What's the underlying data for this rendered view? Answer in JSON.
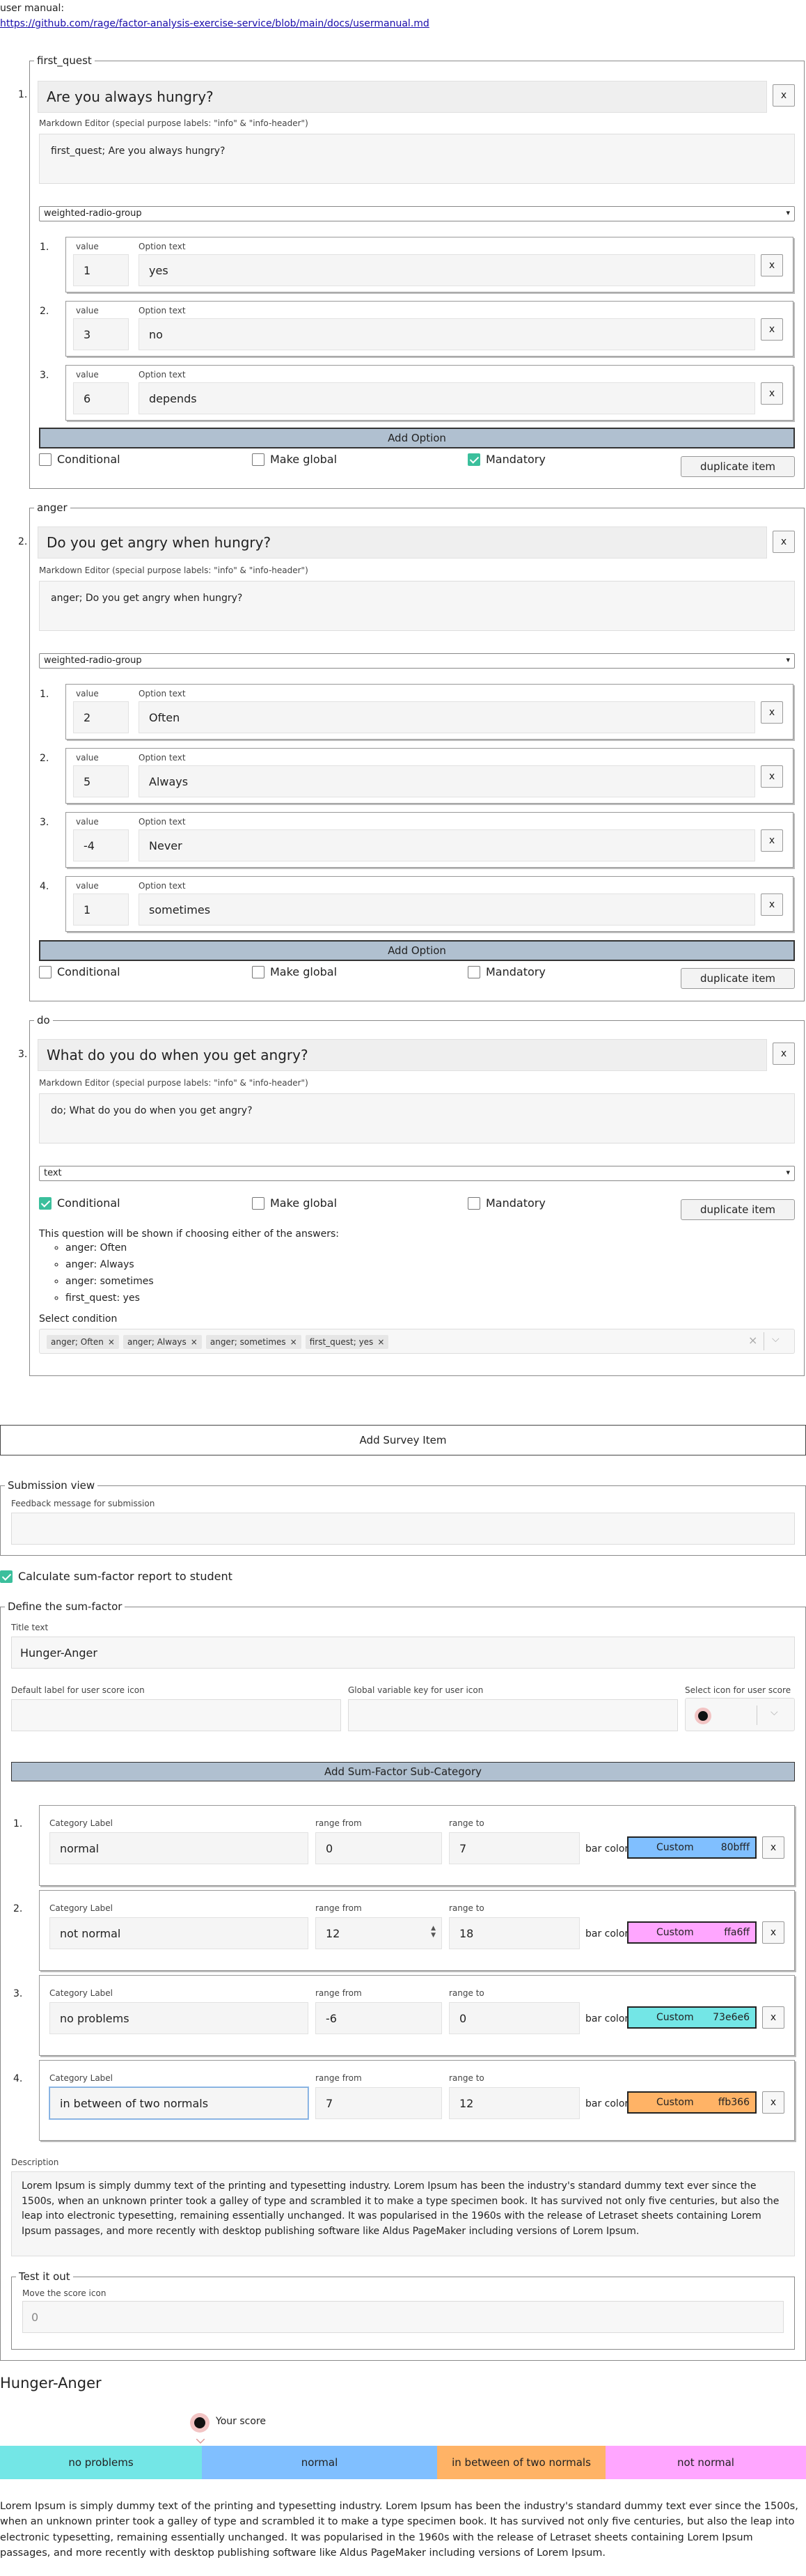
{
  "header": {
    "label": "user manual:",
    "link": "https://github.com/rage/factor-analysis-exercise-service/blob/main/docs/usermanual.md"
  },
  "common": {
    "markdown_label": "Markdown Editor (special purpose labels: \"info\" & \"info-header\")",
    "value_label": "value",
    "option_text_label": "Option text",
    "add_option": "Add Option",
    "conditional": "Conditional",
    "make_global": "Make global",
    "mandatory": "Mandatory",
    "duplicate": "duplicate item",
    "close": "x"
  },
  "items": [
    {
      "number": "1.",
      "legend": "first_quest",
      "title": "Are you always hungry?",
      "markdown": "first_quest; Are you always hungry?",
      "type": "weighted-radio-group",
      "options": [
        {
          "number": "1.",
          "value": "1",
          "text": "yes"
        },
        {
          "number": "2.",
          "value": "3",
          "text": "no"
        },
        {
          "number": "3.",
          "value": "6",
          "text": "depends"
        }
      ],
      "conditional": false,
      "make_global": false,
      "mandatory": true
    },
    {
      "number": "2.",
      "legend": "anger",
      "title": "Do you get angry when hungry?",
      "markdown": "anger; Do you get angry when hungry?",
      "type": "weighted-radio-group",
      "options": [
        {
          "number": "1.",
          "value": "2",
          "text": "Often"
        },
        {
          "number": "2.",
          "value": "5",
          "text": "Always"
        },
        {
          "number": "3.",
          "value": "-4",
          "text": "Never"
        },
        {
          "number": "4.",
          "value": "1",
          "text": "sometimes"
        }
      ],
      "conditional": false,
      "make_global": false,
      "mandatory": false
    },
    {
      "number": "3.",
      "legend": "do",
      "title": "What do you do when you get angry?",
      "markdown": "do; What do you do when you get angry?",
      "type": "text",
      "conditional": true,
      "make_global": false,
      "mandatory": false,
      "condition_intro": "This question will be shown if choosing either of the answers:",
      "condition_answers": [
        "anger: Often",
        "anger: Always",
        "anger: sometimes",
        "first_quest: yes"
      ],
      "select_condition_label": "Select condition",
      "condition_tags": [
        "anger; Often",
        "anger; Always",
        "anger; sometimes",
        "first_quest; yes"
      ],
      "clear_icon": "×",
      "chevron_icon": "⌵"
    }
  ],
  "add_survey_item": "Add Survey Item",
  "submission": {
    "legend": "Submission view",
    "feedback_label": "Feedback message for submission",
    "feedback_value": ""
  },
  "sum_factor_toggle": {
    "label": "Calculate sum-factor report to student",
    "checked": true
  },
  "sum_factor": {
    "legend": "Define the sum-factor",
    "title_label": "Title text",
    "title_value": "Hunger-Anger",
    "default_label_label": "Default label for user score icon",
    "default_label_value": "",
    "global_key_label": "Global variable key for user icon",
    "global_key_value": "",
    "icon_label": "Select icon for user score",
    "add_sub_category": "Add Sum-Factor Sub-Category",
    "category_label": "Category Label",
    "range_from_label": "range from",
    "range_to_label": "range to",
    "bar_color_label": "bar color",
    "custom_label": "Custom",
    "categories": [
      {
        "number": "1.",
        "label": "normal",
        "from": "0",
        "to": "7",
        "color": "#80bfff",
        "hex": "80bfff"
      },
      {
        "number": "2.",
        "label": "not normal",
        "from": "12",
        "to": "18",
        "color": "#ffa6ff",
        "hex": "ffa6ff"
      },
      {
        "number": "3.",
        "label": "no problems",
        "from": "-6",
        "to": "0",
        "color": "#73e6e6",
        "hex": "73e6e6"
      },
      {
        "number": "4.",
        "label": "in between of two normals",
        "from": "7",
        "to": "12",
        "color": "#ffb366",
        "hex": "ffb366"
      }
    ],
    "description_label": "Description",
    "description": "Lorem Ipsum is simply dummy text of the printing and typesetting industry. Lorem Ipsum has been the industry's standard dummy text ever since the 1500s, when an unknown printer took a galley of type and scrambled it to make a type specimen book. It has survived not only five centuries, but also the leap into electronic typesetting, remaining essentially unchanged. It was popularised in the 1960s with the release of Letraset sheets containing Lorem Ipsum passages, and more recently with desktop publishing software like Aldus PageMaker including versions of Lorem Ipsum.",
    "test_legend": "Test it out",
    "move_icon_label": "Move the score icon",
    "move_icon_value": "0"
  },
  "preview": {
    "title": "Hunger-Anger",
    "score_label": "Your score",
    "segments": [
      {
        "label": "no problems",
        "color": "#73e6e6"
      },
      {
        "label": "normal",
        "color": "#80bfff"
      },
      {
        "label": "in between of two normals",
        "color": "#ffb366"
      },
      {
        "label": "not normal",
        "color": "#ffa6ff"
      }
    ],
    "description": "Lorem Ipsum is simply dummy text of the printing and typesetting industry. Lorem Ipsum has been the industry's standard dummy text ever since the 1500s, when an unknown printer took a galley of type and scrambled it to make a type specimen book. It has survived not only five centuries, but also the leap into electronic typesetting, remaining essentially unchanged. It was popularised in the 1960s with the release of Letraset sheets containing Lorem Ipsum passages, and more recently with desktop publishing software like Aldus PageMaker including versions of Lorem Ipsum."
  },
  "icons": {
    "dropdown": "chevron-down-icon",
    "score_icon": "circle-dot-icon"
  },
  "colors": {
    "accent_check": "#3bbf9c",
    "add_button_bg": "#b0c0d0"
  }
}
